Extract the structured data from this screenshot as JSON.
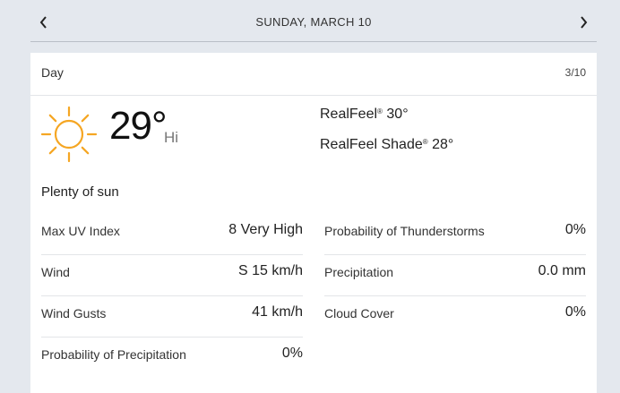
{
  "nav": {
    "date": "SUNDAY, MARCH 10",
    "prev_icon": "chevron-left-icon",
    "next_icon": "chevron-right-icon"
  },
  "card": {
    "title": "Day",
    "date": "3/10",
    "icon": "sun-icon",
    "icon_color": "#f5a623",
    "temperature": "29°",
    "temp_suffix": "Hi",
    "realfeel_label": "RealFeel",
    "realfeel_value": "30°",
    "realfeel_shade_label": "RealFeel Shade",
    "realfeel_shade_value": "28°",
    "trademark": "®",
    "phrase": "Plenty of sun"
  },
  "details_left": [
    {
      "label": "Max UV Index",
      "value": "8 Very High"
    },
    {
      "label": "Wind",
      "value": "S 15 km/h"
    },
    {
      "label": "Wind Gusts",
      "value": "41 km/h"
    },
    {
      "label": "Probability of Precipitation",
      "value": "0%"
    }
  ],
  "details_right": [
    {
      "label": "Probability of Thunderstorms",
      "value": "0%"
    },
    {
      "label": "Precipitation",
      "value": "0.0 mm"
    },
    {
      "label": "Cloud Cover",
      "value": "0%"
    }
  ]
}
